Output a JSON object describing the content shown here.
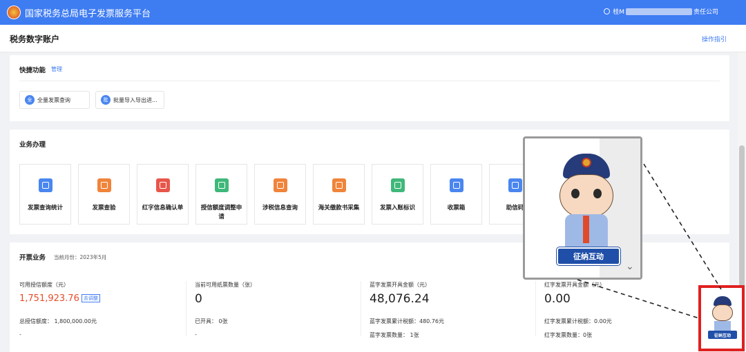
{
  "header": {
    "brand": "国家税务总局电子发票服务平台",
    "user_prefix": "桂M",
    "user_suffix": "责任公司"
  },
  "page": {
    "title": "税务数字账户",
    "guide_link": "操作指引"
  },
  "quick": {
    "title": "快捷功能",
    "manage": "管理",
    "buttons": [
      {
        "icon_text": "全",
        "label": "全量发票查询"
      },
      {
        "icon_text": "批",
        "label": "批量导入导出进..."
      }
    ]
  },
  "business": {
    "title": "业务办理",
    "tiles": [
      {
        "label": "发票查询统计",
        "color": "#4a86f0",
        "icon": "search-doc-icon"
      },
      {
        "label": "发票查验",
        "color": "#f0843a",
        "icon": "scan-icon"
      },
      {
        "label": "红字信息确认单",
        "color": "#e8564a",
        "icon": "doc-check-icon"
      },
      {
        "label": "授信额度调整申请",
        "color": "#3fb87a",
        "icon": "edit-doc-icon"
      },
      {
        "label": "涉税信息查询",
        "color": "#f0843a",
        "icon": "folder-search-icon"
      },
      {
        "label": "海关缴款书采集",
        "color": "#f0843a",
        "icon": "customs-doc-icon"
      },
      {
        "label": "发票入账标识",
        "color": "#3fb87a",
        "icon": "tag-icon"
      },
      {
        "label": "收票箱",
        "color": "#4a86f0",
        "icon": "mail-icon"
      },
      {
        "label": "助信码",
        "color": "#4a86f0",
        "icon": "qr-icon"
      }
    ]
  },
  "invoicing": {
    "title": "开票业务",
    "month": "当前月份：2023年5月",
    "stats": [
      {
        "label": "可用授信额度（元）",
        "value": "1,751,923.76",
        "action": "去调整",
        "line1": "总授信额度： 1,800,000.00元",
        "line2": "-"
      },
      {
        "label": "当前可用纸票数量（张）",
        "value": "0",
        "line1": "已开具： 0张",
        "line2": "-"
      },
      {
        "label": "蓝字发票开具金额（元）",
        "value": "48,076.24",
        "line1": "蓝字发票累计税额：480.76元",
        "line2": "蓝字发票数量： 1张"
      },
      {
        "label": "红字发票开具金额（元）",
        "value": "0.00",
        "line1": "红字发票累计税额：0.00元",
        "line2": "红字发票数量：0张"
      }
    ]
  },
  "assistant": {
    "banner": "征纳互动",
    "mini_banner": "征纳互动"
  },
  "colors": {
    "primary": "#3e7cf2",
    "highlight_red": "#e02020",
    "amount_red": "#e84b2a"
  }
}
